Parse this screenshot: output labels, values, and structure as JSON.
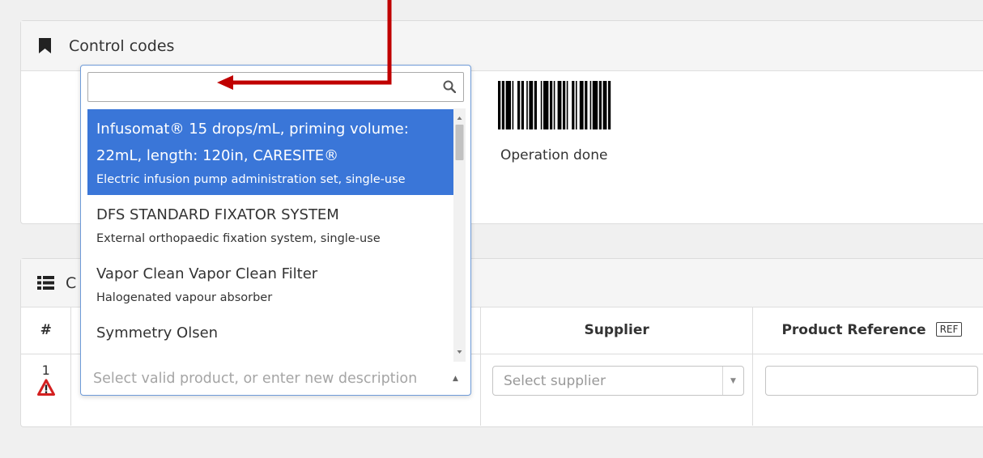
{
  "control_panel": {
    "title": "Control codes",
    "barcode_caption": "Operation done"
  },
  "list_panel": {
    "title_fragment": "C",
    "columns": {
      "num": "#",
      "product": "",
      "supplier": "Supplier",
      "reference": "Product Reference",
      "reference_badge": "REF"
    },
    "rows": [
      {
        "num": "1"
      }
    ],
    "supplier_placeholder": "Select supplier",
    "reference_value": ""
  },
  "dropdown": {
    "search_value": "",
    "options": [
      {
        "title": "Infusomat® 15 drops/mL, priming volume: 22mL, length: 120in, CARESITE®",
        "subtitle": "Electric infusion pump administration set, single-use",
        "selected": true
      },
      {
        "title": "DFS STANDARD FIXATOR SYSTEM",
        "subtitle": "External orthopaedic fixation system, single-use",
        "selected": false
      },
      {
        "title": "Vapor Clean Vapor Clean Filter",
        "subtitle": "Halogenated vapour absorber",
        "selected": false
      },
      {
        "title": "Symmetry Olsen",
        "subtitle": "",
        "selected": false
      }
    ],
    "placeholder": "Select valid product, or enter new description"
  },
  "colors": {
    "selected_bg": "#3a76d8",
    "annotation_arrow": "#c00000",
    "warning": "#d42020"
  },
  "icons": {
    "panel1": "bookmark-icon",
    "panel2": "list-icon",
    "search": "search-icon",
    "warning": "warning-icon",
    "annotation": "red-arrow-annotation"
  }
}
